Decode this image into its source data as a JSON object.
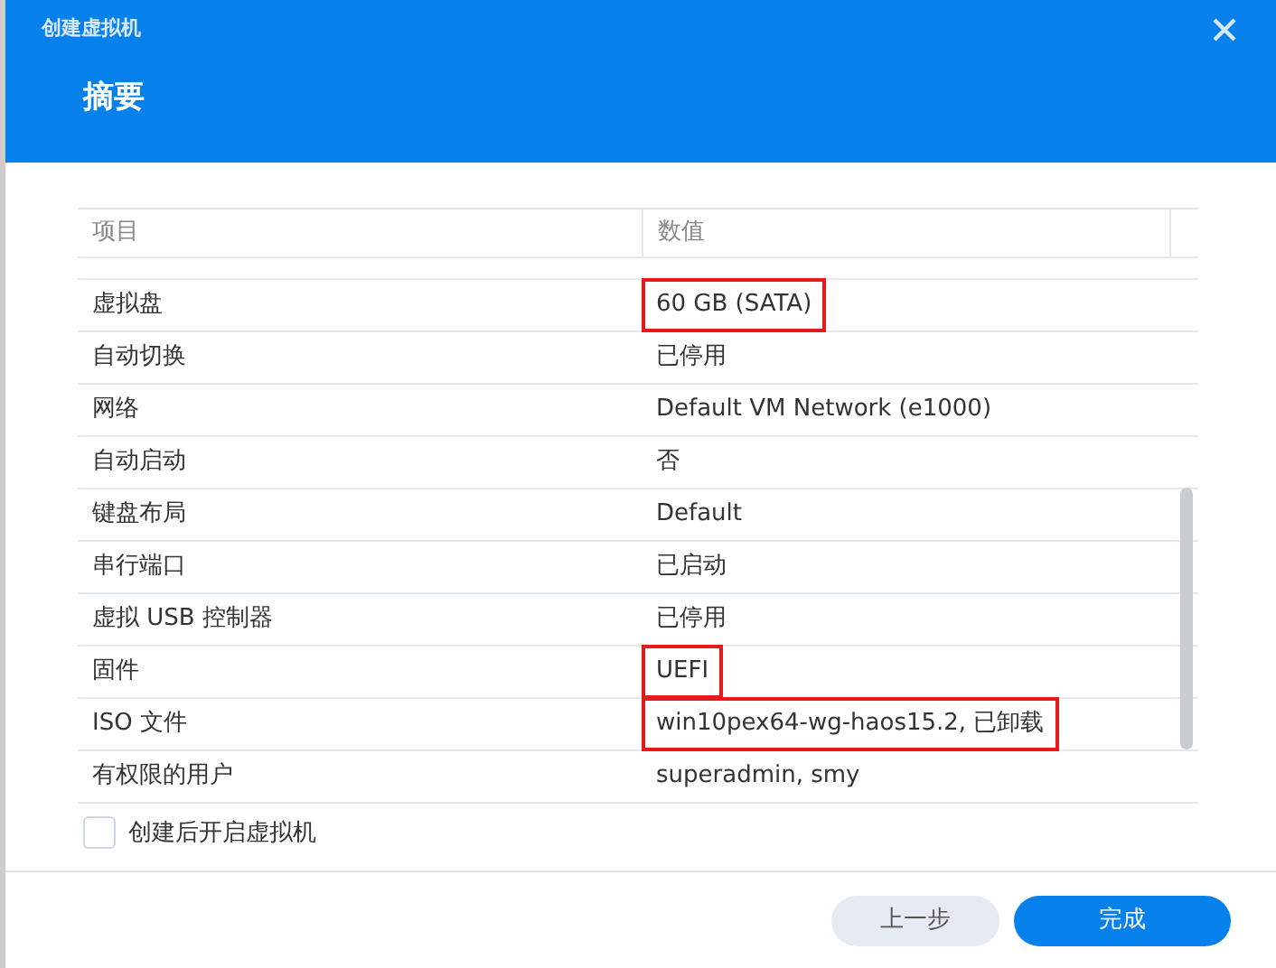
{
  "window": {
    "title": "创建虚拟机"
  },
  "heading": "摘要",
  "table": {
    "columns": [
      "项目",
      "数值"
    ],
    "rows": [
      {
        "item": "虚拟盘",
        "value": "60 GB (SATA)",
        "highlighted": true
      },
      {
        "item": "自动切换",
        "value": "已停用",
        "highlighted": false
      },
      {
        "item": "网络",
        "value": "Default VM Network (e1000)",
        "highlighted": false
      },
      {
        "item": "自动启动",
        "value": "否",
        "highlighted": false
      },
      {
        "item": "键盘布局",
        "value": "Default",
        "highlighted": false
      },
      {
        "item": "串行端口",
        "value": "已启动",
        "highlighted": false
      },
      {
        "item": "虚拟 USB 控制器",
        "value": "已停用",
        "highlighted": false
      },
      {
        "item": "固件",
        "value": "UEFI",
        "highlighted": true
      },
      {
        "item": "ISO 文件",
        "value": "win10pex64-wg-haos15.2, 已卸载",
        "highlighted": true
      },
      {
        "item": "有权限的用户",
        "value": "superadmin, smy",
        "highlighted": false
      }
    ]
  },
  "option": {
    "label": "创建后开启虚拟机",
    "checked": false
  },
  "buttons": [
    {
      "label": "上一步",
      "kind": "secondary"
    },
    {
      "label": "完成",
      "kind": "primary"
    }
  ]
}
